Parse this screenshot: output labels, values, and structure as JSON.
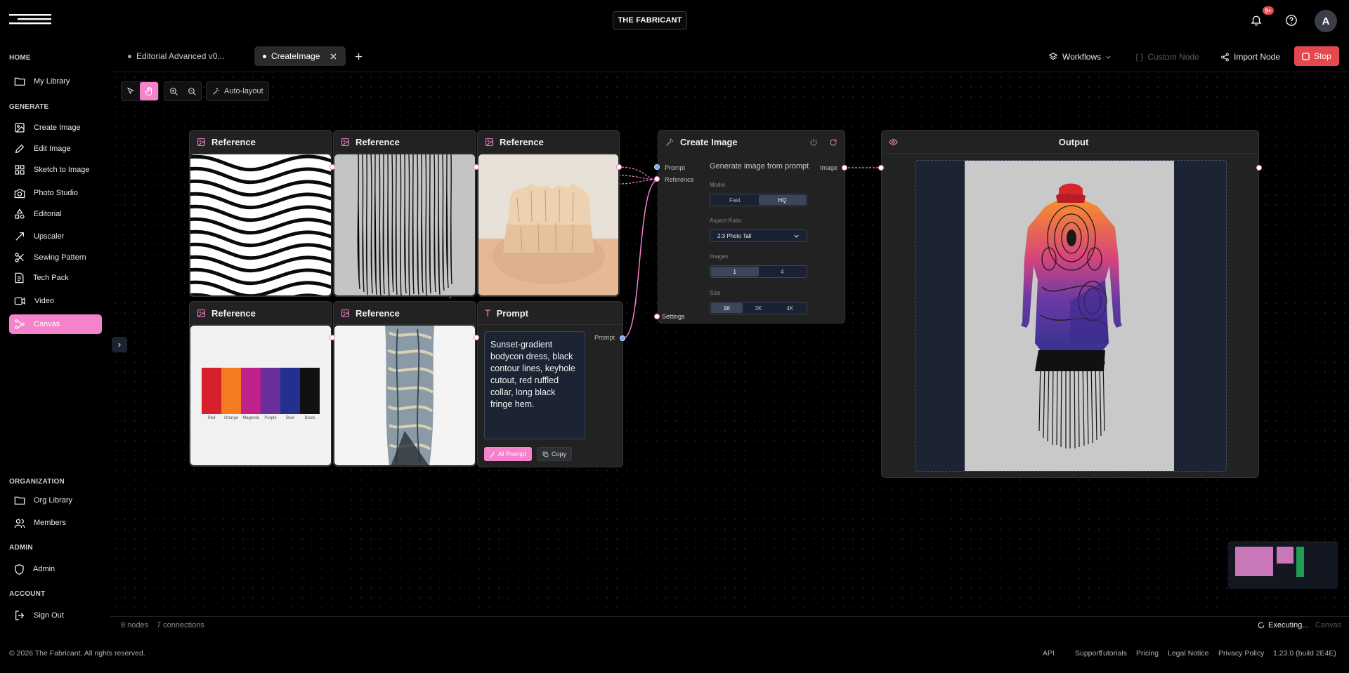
{
  "app": {
    "brand": "THE FABRICANT",
    "notification_count": "9+",
    "avatar_initial": "A"
  },
  "sidebar": {
    "sections": {
      "home": "HOME",
      "generate": "GENERATE",
      "organization": "ORGANIZATION",
      "admin": "ADMIN",
      "account": "ACCOUNT"
    },
    "items": [
      {
        "label": "My Library",
        "icon": "folder-icon"
      },
      {
        "label": "Create Image",
        "icon": "image-icon"
      },
      {
        "label": "Edit Image",
        "icon": "pencil-icon"
      },
      {
        "label": "Sketch to Image",
        "icon": "grid-icon"
      },
      {
        "label": "Photo Studio",
        "icon": "camera-icon"
      },
      {
        "label": "Editorial",
        "icon": "shapes-icon"
      },
      {
        "label": "Upscaler",
        "icon": "upscale-icon"
      },
      {
        "label": "Sewing Pattern",
        "icon": "scissors-icon"
      },
      {
        "label": "Tech Pack",
        "icon": "document-icon"
      },
      {
        "label": "Video",
        "icon": "video-icon"
      },
      {
        "label": "Canvas",
        "icon": "canvas-icon",
        "active": true
      },
      {
        "label": "Org Library",
        "icon": "folder-icon"
      },
      {
        "label": "Members",
        "icon": "users-icon"
      },
      {
        "label": "Admin",
        "icon": "shield-icon"
      },
      {
        "label": "Sign Out",
        "icon": "sign-out-icon"
      }
    ]
  },
  "tabs": [
    {
      "label": "Editorial Advanced v0...",
      "active": false
    },
    {
      "label": "CreateImage",
      "active": true
    }
  ],
  "toolbar": {
    "workflows": "Workflows",
    "custom_node": "Custom Node",
    "import_node": "Import Node",
    "stop": "Stop",
    "auto_layout": "Auto-layout"
  },
  "nodes": {
    "reference_title": "Reference",
    "prompt": {
      "title": "Prompt",
      "text": "Sunset-gradient bodycon dress, black contour lines, keyhole cutout, red ruffled collar, long black fringe hem.",
      "output_label": "Prompt",
      "ai_prompt": "AI Prompt",
      "copy": "Copy"
    },
    "create_image": {
      "title": "Create Image",
      "inputs": {
        "prompt": "Prompt",
        "reference": "Reference",
        "settings": "Settings"
      },
      "output": "Image",
      "description": "Generate image from prompt",
      "model_label": "Model",
      "model_options": [
        "Fast",
        "HQ"
      ],
      "model_selected": "HQ",
      "aspect_label": "Aspect Ratio",
      "aspect_value": "2:3 Photo Tall",
      "images_label": "Images",
      "images_options": [
        "1",
        "4"
      ],
      "images_selected": "1",
      "size_label": "Size",
      "size_options": [
        "1K",
        "2K",
        "4K"
      ],
      "size_selected": "1K"
    },
    "output": {
      "title": "Output"
    },
    "swatches": [
      {
        "label": "Red",
        "color": "#d81f2c"
      },
      {
        "label": "Orange",
        "color": "#f47b20"
      },
      {
        "label": "Magenta",
        "color": "#c0218a"
      },
      {
        "label": "Purple",
        "color": "#6a2f9a"
      },
      {
        "label": "Blue",
        "color": "#23308f"
      },
      {
        "label": "Black",
        "color": "#111111"
      }
    ]
  },
  "status": {
    "nodes": "8 nodes",
    "connections": "7 connections",
    "executing": "Executing...",
    "canvas": "Canvas"
  },
  "footer": {
    "copyright": "© 2026 The Fabricant. All rights reserved.",
    "links": [
      "API",
      "Support",
      "Tutorials",
      "Pricing",
      "Legal Notice",
      "Privacy Policy"
    ],
    "version": "1.23.0 (build 2E4E)"
  },
  "colors": {
    "accent_pink": "#f582cb",
    "stop_red": "#e5484d",
    "port_blue": "#7aa8ff"
  }
}
